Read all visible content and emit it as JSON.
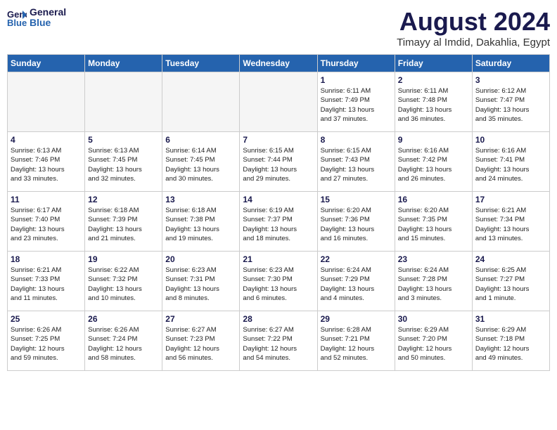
{
  "header": {
    "logo_line1": "General",
    "logo_line2": "Blue",
    "month_title": "August 2024",
    "location": "Timayy al Imdid, Dakahlia, Egypt"
  },
  "weekdays": [
    "Sunday",
    "Monday",
    "Tuesday",
    "Wednesday",
    "Thursday",
    "Friday",
    "Saturday"
  ],
  "weeks": [
    [
      {
        "day": "",
        "info": ""
      },
      {
        "day": "",
        "info": ""
      },
      {
        "day": "",
        "info": ""
      },
      {
        "day": "",
        "info": ""
      },
      {
        "day": "1",
        "info": "Sunrise: 6:11 AM\nSunset: 7:49 PM\nDaylight: 13 hours\nand 37 minutes."
      },
      {
        "day": "2",
        "info": "Sunrise: 6:11 AM\nSunset: 7:48 PM\nDaylight: 13 hours\nand 36 minutes."
      },
      {
        "day": "3",
        "info": "Sunrise: 6:12 AM\nSunset: 7:47 PM\nDaylight: 13 hours\nand 35 minutes."
      }
    ],
    [
      {
        "day": "4",
        "info": "Sunrise: 6:13 AM\nSunset: 7:46 PM\nDaylight: 13 hours\nand 33 minutes."
      },
      {
        "day": "5",
        "info": "Sunrise: 6:13 AM\nSunset: 7:45 PM\nDaylight: 13 hours\nand 32 minutes."
      },
      {
        "day": "6",
        "info": "Sunrise: 6:14 AM\nSunset: 7:45 PM\nDaylight: 13 hours\nand 30 minutes."
      },
      {
        "day": "7",
        "info": "Sunrise: 6:15 AM\nSunset: 7:44 PM\nDaylight: 13 hours\nand 29 minutes."
      },
      {
        "day": "8",
        "info": "Sunrise: 6:15 AM\nSunset: 7:43 PM\nDaylight: 13 hours\nand 27 minutes."
      },
      {
        "day": "9",
        "info": "Sunrise: 6:16 AM\nSunset: 7:42 PM\nDaylight: 13 hours\nand 26 minutes."
      },
      {
        "day": "10",
        "info": "Sunrise: 6:16 AM\nSunset: 7:41 PM\nDaylight: 13 hours\nand 24 minutes."
      }
    ],
    [
      {
        "day": "11",
        "info": "Sunrise: 6:17 AM\nSunset: 7:40 PM\nDaylight: 13 hours\nand 23 minutes."
      },
      {
        "day": "12",
        "info": "Sunrise: 6:18 AM\nSunset: 7:39 PM\nDaylight: 13 hours\nand 21 minutes."
      },
      {
        "day": "13",
        "info": "Sunrise: 6:18 AM\nSunset: 7:38 PM\nDaylight: 13 hours\nand 19 minutes."
      },
      {
        "day": "14",
        "info": "Sunrise: 6:19 AM\nSunset: 7:37 PM\nDaylight: 13 hours\nand 18 minutes."
      },
      {
        "day": "15",
        "info": "Sunrise: 6:20 AM\nSunset: 7:36 PM\nDaylight: 13 hours\nand 16 minutes."
      },
      {
        "day": "16",
        "info": "Sunrise: 6:20 AM\nSunset: 7:35 PM\nDaylight: 13 hours\nand 15 minutes."
      },
      {
        "day": "17",
        "info": "Sunrise: 6:21 AM\nSunset: 7:34 PM\nDaylight: 13 hours\nand 13 minutes."
      }
    ],
    [
      {
        "day": "18",
        "info": "Sunrise: 6:21 AM\nSunset: 7:33 PM\nDaylight: 13 hours\nand 11 minutes."
      },
      {
        "day": "19",
        "info": "Sunrise: 6:22 AM\nSunset: 7:32 PM\nDaylight: 13 hours\nand 10 minutes."
      },
      {
        "day": "20",
        "info": "Sunrise: 6:23 AM\nSunset: 7:31 PM\nDaylight: 13 hours\nand 8 minutes."
      },
      {
        "day": "21",
        "info": "Sunrise: 6:23 AM\nSunset: 7:30 PM\nDaylight: 13 hours\nand 6 minutes."
      },
      {
        "day": "22",
        "info": "Sunrise: 6:24 AM\nSunset: 7:29 PM\nDaylight: 13 hours\nand 4 minutes."
      },
      {
        "day": "23",
        "info": "Sunrise: 6:24 AM\nSunset: 7:28 PM\nDaylight: 13 hours\nand 3 minutes."
      },
      {
        "day": "24",
        "info": "Sunrise: 6:25 AM\nSunset: 7:27 PM\nDaylight: 13 hours\nand 1 minute."
      }
    ],
    [
      {
        "day": "25",
        "info": "Sunrise: 6:26 AM\nSunset: 7:25 PM\nDaylight: 12 hours\nand 59 minutes."
      },
      {
        "day": "26",
        "info": "Sunrise: 6:26 AM\nSunset: 7:24 PM\nDaylight: 12 hours\nand 58 minutes."
      },
      {
        "day": "27",
        "info": "Sunrise: 6:27 AM\nSunset: 7:23 PM\nDaylight: 12 hours\nand 56 minutes."
      },
      {
        "day": "28",
        "info": "Sunrise: 6:27 AM\nSunset: 7:22 PM\nDaylight: 12 hours\nand 54 minutes."
      },
      {
        "day": "29",
        "info": "Sunrise: 6:28 AM\nSunset: 7:21 PM\nDaylight: 12 hours\nand 52 minutes."
      },
      {
        "day": "30",
        "info": "Sunrise: 6:29 AM\nSunset: 7:20 PM\nDaylight: 12 hours\nand 50 minutes."
      },
      {
        "day": "31",
        "info": "Sunrise: 6:29 AM\nSunset: 7:18 PM\nDaylight: 12 hours\nand 49 minutes."
      }
    ]
  ]
}
